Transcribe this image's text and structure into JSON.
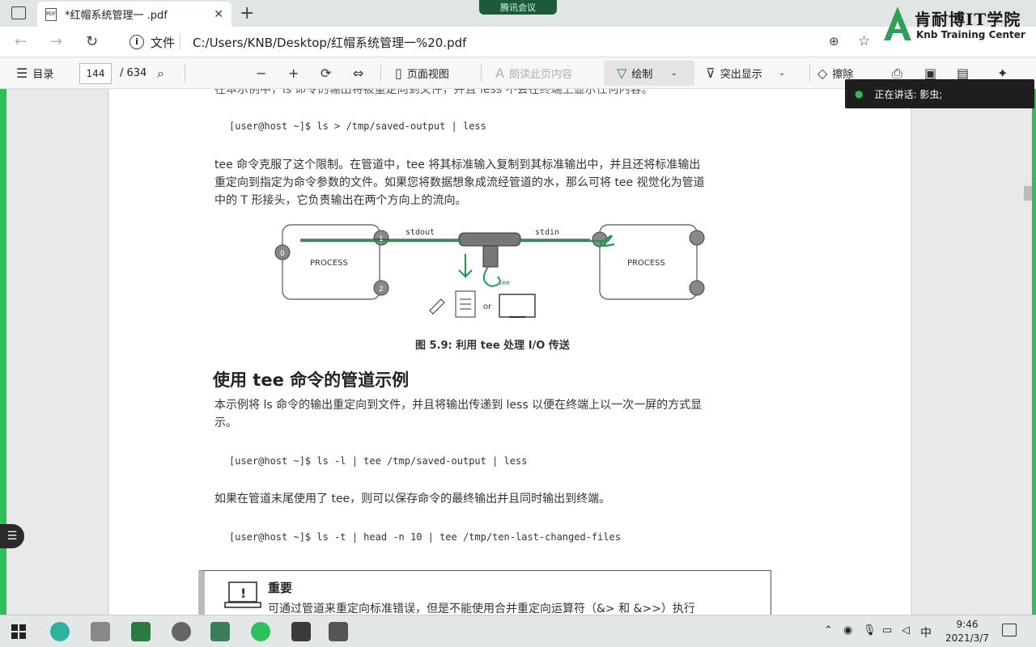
{
  "browser": {
    "tab_title": "*红帽系统管理一 .pdf",
    "meeting_label": "腾讯会议",
    "address_label": "文件",
    "url": "C:/Users/KNB/Desktop/红帽系统管理一%20.pdf"
  },
  "logo": {
    "title": "肯耐博IT学院",
    "subtitle": "Knb Training Center"
  },
  "pdf_toolbar": {
    "toc": "目录",
    "page_current": "144",
    "page_total": "/ 634",
    "page_view": "页面视图",
    "read_aloud": "朗读此页内容",
    "draw": "绘制",
    "highlight": "突出显示",
    "erase": "擦除"
  },
  "speaking_indicator": "正在讲话: 影虫;",
  "page": {
    "top_partial": "在本示例中，ls 命令的输出将被重定向到文件，并且 less 不会在终端上显示任何内容。",
    "code1": "[user@host ~]$ ls > /tmp/saved-output | less",
    "para1_line1": "tee 命令克服了这个限制。在管道中，tee 将其标准输入复制到其标准输出中，并且还将标准输出",
    "para1_line2": "重定向到指定为命令参数的文件。如果您将数据想象成流经管道的水，那么可将 tee 视觉化为管道",
    "para1_line3": "中的 T 形接头，它负责输出在两个方向上的流向。",
    "diagram": {
      "process_left": "PROCESS",
      "process_right": "PROCESS",
      "stdout": "stdout",
      "stdin": "stdin",
      "fd0": "0",
      "fd1": "1",
      "fd2": "2",
      "or": "or",
      "tee": "tee"
    },
    "caption": "图 5.9: 利用 tee 处理 I/O 传送",
    "heading": "使用 tee 命令的管道示例",
    "para2_line1": "本示例将 ls 命令的输出重定向到文件，并且将输出传递到 less 以便在终端上以一次一屏的方式显",
    "para2_line2": "示。",
    "code2": "[user@host ~]$ ls -l | tee /tmp/saved-output | less",
    "para3": "如果在管道末尾使用了 tee，则可以保存命令的最终输出并且同时输出到终端。",
    "code3": "[user@host ~]$ ls -t | head -n 10 | tee /tmp/ten-last-changed-files",
    "note_title": "重要",
    "note_body": "可通过管道来重定向标准错误，但是不能使用合并重定向运算符（&> 和 &>>）执行"
  },
  "taskbar": {
    "ime": "中",
    "time": "9:46",
    "date": "2021/3/7"
  }
}
